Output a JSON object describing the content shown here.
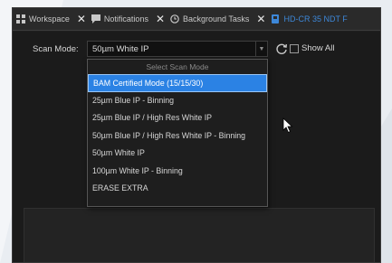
{
  "tabs": [
    {
      "label": "Workspace",
      "icon": "grid-icon",
      "closable": true,
      "active": false
    },
    {
      "label": "Notifications",
      "icon": "chat-icon",
      "closable": true,
      "active": false
    },
    {
      "label": "Background Tasks",
      "icon": "clock-icon",
      "closable": true,
      "active": false
    },
    {
      "label": "HD-CR 35 NDT F",
      "icon": "device-icon",
      "closable": false,
      "active": true
    }
  ],
  "scan": {
    "label": "Scan Mode:",
    "current_value": "50µm White IP",
    "show_all_label": "Show All",
    "show_all_checked": false
  },
  "dropdown": {
    "header": "Select Scan Mode",
    "items": [
      {
        "label": "BAM Certified Mode (15/15/30)",
        "selected": true
      },
      {
        "label": "25µm Blue IP - Binning",
        "selected": false
      },
      {
        "label": "25µm Blue IP / High Res White IP",
        "selected": false
      },
      {
        "label": "50µm Blue IP / High Res White IP - Binning",
        "selected": false
      },
      {
        "label": "50µm White IP",
        "selected": false
      },
      {
        "label": "100µm White IP - Binning",
        "selected": false
      },
      {
        "label": "ERASE EXTRA",
        "selected": false
      }
    ]
  },
  "colors": {
    "accent": "#2b82e4",
    "background": "#1b1b1b",
    "active_tab": "#3d87d8"
  }
}
